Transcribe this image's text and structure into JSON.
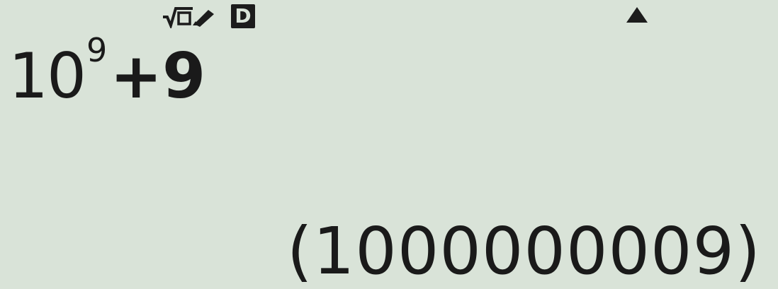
{
  "status_bar": {
    "input_mode_icon": "mathio-sqrt-pencil-icon",
    "angle_mode": "D",
    "scroll_indicator_icon": "triangle-up-icon"
  },
  "expression": {
    "base": "10",
    "exponent": "9",
    "rest": "+9"
  },
  "result": {
    "text": "(1000000009)"
  },
  "colors": {
    "lcd_background": "#d9e3d8",
    "lcd_foreground": "#1a1a1a"
  }
}
